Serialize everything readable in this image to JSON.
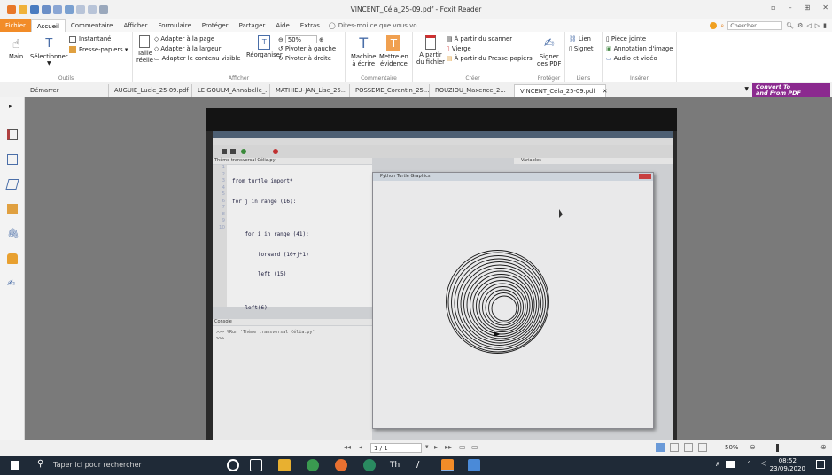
{
  "window": {
    "title": "VINCENT_Céla_25-09.pdf - Foxit Reader"
  },
  "ribbon_tabs": [
    "Fichier",
    "Accueil",
    "Commentaire",
    "Afficher",
    "Formulaire",
    "Protéger",
    "Partager",
    "Aide",
    "Extras"
  ],
  "tell_me": "Dites-moi ce que vous vo",
  "search_placeholder": "Chercher",
  "ribbon": {
    "outils": {
      "label": "Outils",
      "main": "Main",
      "selectionner": "Sélectionner",
      "instantane": "Instantané",
      "presse_papiers": "Presse-papiers"
    },
    "afficher": {
      "label": "Afficher",
      "taille_reelle_1": "Taille",
      "taille_reelle_2": "réelle",
      "adapter_page": "Adapter à la page",
      "adapter_largeur": "Adapter à la largeur",
      "adapter_visible": "Adapter le contenu visible",
      "reorganiser": "Réorganiser",
      "zoom": "50%",
      "pivoter_gauche": "Pivoter à gauche",
      "pivoter_droite": "Pivoter à droite"
    },
    "commentaire": {
      "label": "Commentaire",
      "machine_1": "Machine",
      "machine_2": "à écrire",
      "mettre_1": "Mettre en",
      "mettre_2": "évidence"
    },
    "creer": {
      "label": "Créer",
      "apartir_1": "À partir",
      "apartir_2": "du fichier",
      "scanner": "À partir du scanner",
      "vierge": "Vierge",
      "presse_papiers": "À partir du Presse-papiers"
    },
    "proteger": {
      "label": "Protéger",
      "signer_1": "Signer",
      "signer_2": "des PDF"
    },
    "liens": {
      "label": "Liens",
      "lien": "Lien",
      "signet": "Signet"
    },
    "inserer": {
      "label": "Insérer",
      "piece_jointe": "Pièce jointe",
      "annotation": "Annotation d'image",
      "audio_video": "Audio et vidéo"
    }
  },
  "doc_tabs": [
    "Démarrer",
    "AUGUIE_Lucie_25-09.pdf",
    "LE GOULM_Annabelle_...",
    "MATHIEU-JAN_Lise_25...",
    "POSSEME_Corentin_25...",
    "ROUZIOU_Maxence_2...",
    "VINCENT_Céla_25-09.pdf"
  ],
  "convert_banner": {
    "line1": "Convert To",
    "line2": "and From PDF"
  },
  "photo": {
    "editor_tab": "Thème transversal Célia.py",
    "code_lines": [
      "from turtle import*",
      "for j in range (16):",
      "",
      "    for i in range (41):",
      "        forward (10+j*1)",
      "        left (15)",
      "",
      "    left(6)"
    ],
    "line_numbers": [
      "1",
      "2",
      "3",
      "4",
      "5",
      "6",
      "7",
      "8",
      "9",
      "10"
    ],
    "console_tab": "Console",
    "console_line1": ">>> %Run 'Thème transversal Célia.py'",
    "console_line2": ">>>",
    "turtle_title": "Python Turtle Graphics",
    "variables_label": "Variables"
  },
  "status": {
    "page": "1 / 1",
    "zoom": "50%"
  },
  "taskbar": {
    "search": "Taper ici pour rechercher",
    "time": "08:52",
    "date": "23/09/2020"
  },
  "colors": {
    "accent": "#f28c28",
    "convert_bg": "#8b2a8f",
    "taskbar": "#1f2a37"
  }
}
